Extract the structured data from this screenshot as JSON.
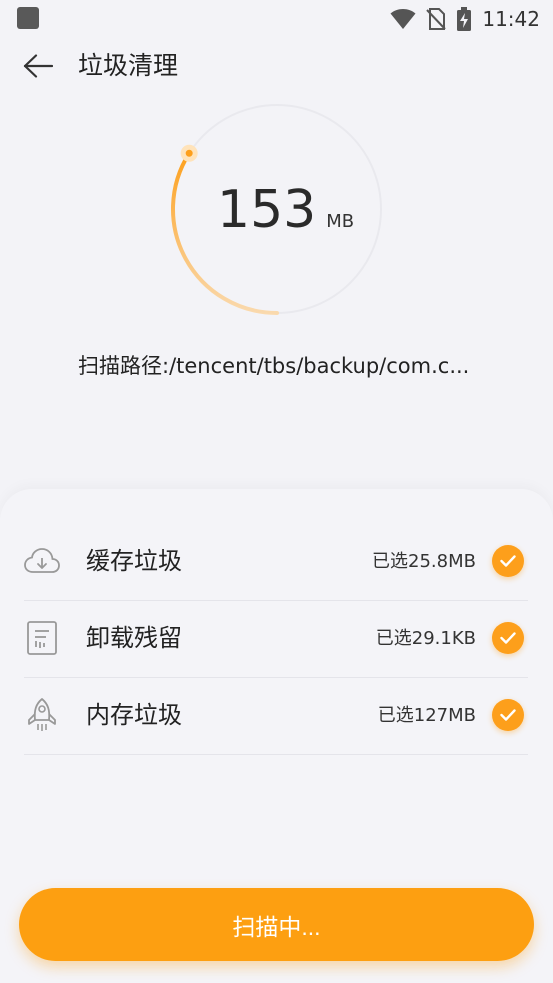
{
  "status_bar": {
    "time": "11:42"
  },
  "header": {
    "title": "垃圾清理"
  },
  "ring": {
    "value": "153",
    "unit": "MB",
    "progress_fraction": 0.34,
    "accent_color": "#fd9f1b"
  },
  "scan_path": "扫描路径:/tencent/tbs/backup/com.c...",
  "items": [
    {
      "label": "缓存垃圾",
      "size": "已选25.8MB",
      "icon": "cloud-download-icon",
      "checked": true
    },
    {
      "label": "卸载残留",
      "size": "已选29.1KB",
      "icon": "document-icon",
      "checked": true
    },
    {
      "label": "内存垃圾",
      "size": "已选127MB",
      "icon": "rocket-icon",
      "checked": true
    }
  ],
  "scan_button": {
    "label": "扫描中..."
  }
}
